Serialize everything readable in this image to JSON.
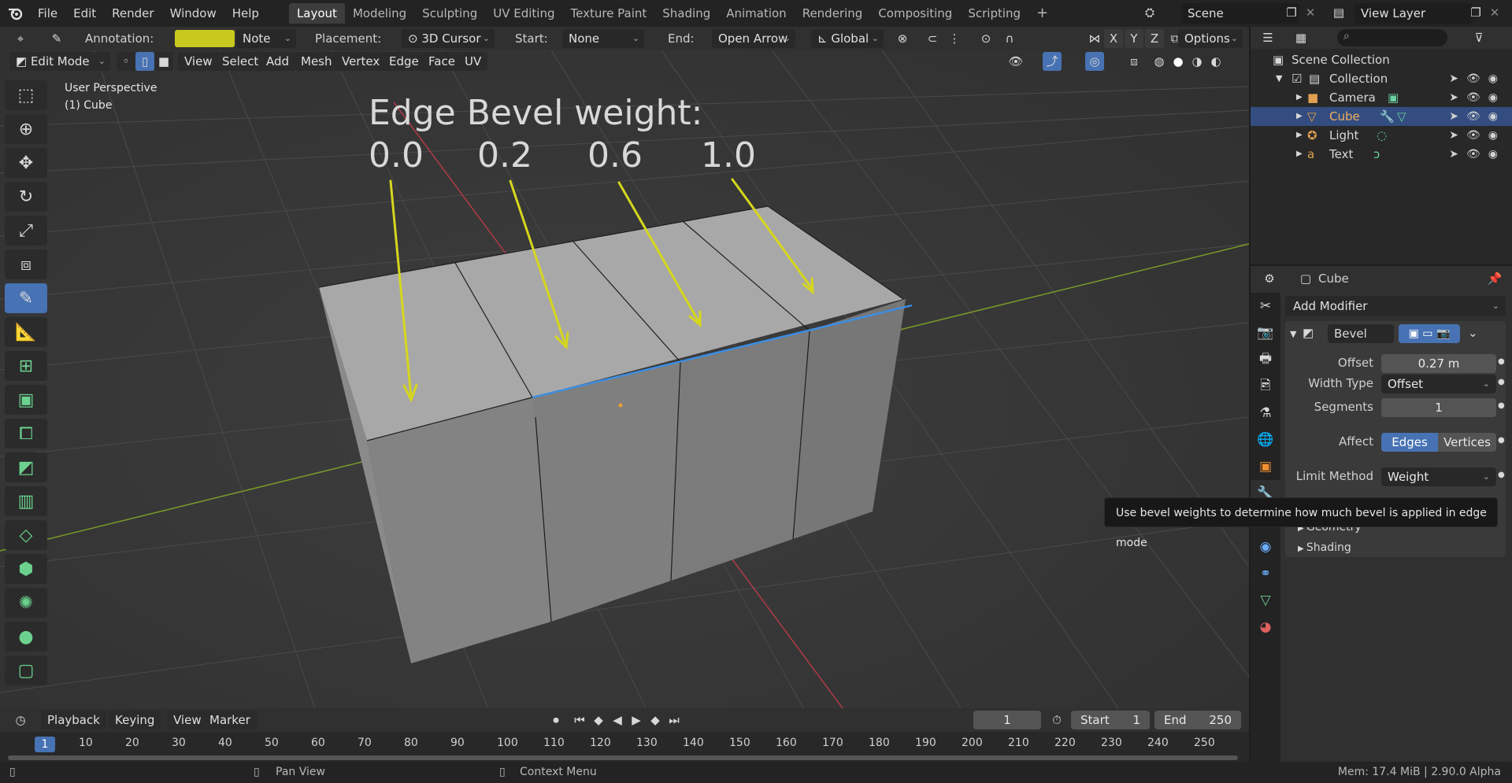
{
  "menu": {
    "items": [
      "File",
      "Edit",
      "Render",
      "Window",
      "Help"
    ]
  },
  "workspaces": [
    "Layout",
    "Modeling",
    "Sculpting",
    "UV Editing",
    "Texture Paint",
    "Shading",
    "Animation",
    "Rendering",
    "Compositing",
    "Scripting"
  ],
  "scene": {
    "label": "Scene",
    "view_layer": "View Layer"
  },
  "tool_settings": {
    "annotation_label": "Annotation:",
    "annotation_color": "#c8c81e",
    "note": "Note",
    "placement_label": "Placement:",
    "placement_value": "3D Cursor",
    "start_label": "Start:",
    "start_value": "None",
    "end_label": "End:",
    "end_value": "Open Arrow",
    "orientation": "Global",
    "axes": [
      "X",
      "Y",
      "Z"
    ],
    "options": "Options"
  },
  "editor_header": {
    "mode": "Edit Mode",
    "menus": [
      "View",
      "Select",
      "Add",
      "Mesh",
      "Vertex",
      "Edge",
      "Face",
      "UV"
    ]
  },
  "viewport": {
    "perspective": "User Perspective",
    "object": "(1) Cube",
    "annotation_title": "Edge Bevel weight:",
    "weights": [
      "0.0",
      "0.2",
      "0.6",
      "1.0"
    ]
  },
  "outliner": {
    "root": "Scene Collection",
    "collection": "Collection",
    "items": [
      "Camera",
      "Cube",
      "Light",
      "Text"
    ]
  },
  "properties": {
    "object_name": "Cube",
    "add_modifier": "Add Modifier",
    "modifier_name": "Bevel",
    "offset_label": "Offset",
    "offset_value": "0.27 m",
    "width_type_label": "Width Type",
    "width_type_value": "Offset",
    "segments_label": "Segments",
    "segments_value": "1",
    "affect_label": "Affect",
    "affect_edges": "Edges",
    "affect_vertices": "Vertices",
    "limit_label": "Limit Method",
    "limit_value": "Weight",
    "geometry": "Geometry",
    "shading": "Shading"
  },
  "tooltip": "Use bevel weights to determine how much bevel is applied in edge mode",
  "timeline": {
    "menus": [
      "Playback",
      "Keying",
      "View",
      "Marker"
    ],
    "current_frame": "1",
    "start_label": "Start",
    "start_value": "1",
    "end_label": "End",
    "end_value": "250",
    "ticks": [
      "1",
      "10",
      "20",
      "30",
      "40",
      "50",
      "60",
      "70",
      "80",
      "90",
      "100",
      "110",
      "120",
      "130",
      "140",
      "150",
      "160",
      "170",
      "180",
      "190",
      "200",
      "210",
      "220",
      "230",
      "240",
      "250"
    ]
  },
  "status": {
    "pan": "Pan View",
    "context": "Context Menu",
    "mem": "Mem: 17.4 MiB | 2.90.0 Alpha"
  }
}
